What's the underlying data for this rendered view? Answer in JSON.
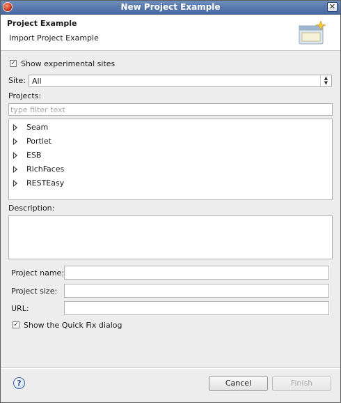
{
  "window": {
    "title": "New Project Example"
  },
  "banner": {
    "title": "Project Example",
    "subtitle": "Import Project Example",
    "image_icon": "wizard-banner-icon"
  },
  "experimental": {
    "label": "Show experimental sites",
    "checked": true
  },
  "site": {
    "label": "Site:",
    "value": "All"
  },
  "projects": {
    "label": "Projects:",
    "filter_placeholder": "type filter text",
    "items": [
      {
        "label": "Seam"
      },
      {
        "label": "Portlet"
      },
      {
        "label": "ESB"
      },
      {
        "label": "RichFaces"
      },
      {
        "label": "RESTEasy"
      }
    ]
  },
  "description": {
    "label": "Description:",
    "value": ""
  },
  "fields": {
    "project_name": {
      "label": "Project name:",
      "value": ""
    },
    "project_size": {
      "label": "Project size:",
      "value": ""
    },
    "url": {
      "label": "URL:",
      "value": ""
    }
  },
  "quickfix": {
    "label": "Show the Quick Fix dialog",
    "checked": true
  },
  "buttons": {
    "cancel": "Cancel",
    "finish": "Finish"
  },
  "icons": {
    "help": "?",
    "close": "✕",
    "checkmark": "✓"
  }
}
